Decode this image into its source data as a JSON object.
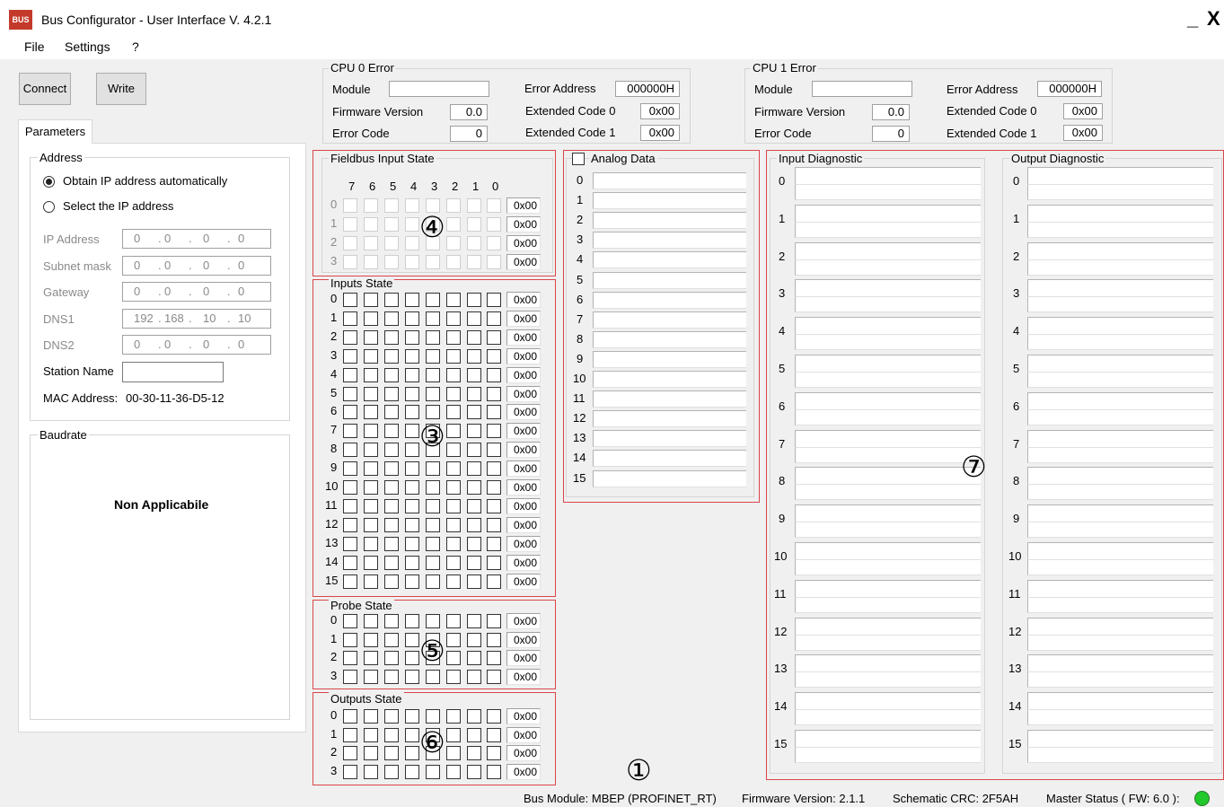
{
  "window": {
    "title": "Bus Configurator - User Interface  V. 4.2.1",
    "icon_label": "BUS",
    "minimize": "_",
    "close": "X"
  },
  "menu": [
    "File",
    "Settings",
    "?"
  ],
  "toolbar": {
    "connect": "Connect",
    "write": "Write"
  },
  "tab": "Parameters",
  "address": {
    "title": "Address",
    "radio_auto": "Obtain IP address automatically",
    "radio_manual": "Select the IP address",
    "fields": [
      {
        "label": "IP Address",
        "octets": [
          "0",
          "0",
          "0",
          "0"
        ]
      },
      {
        "label": "Subnet mask",
        "octets": [
          "0",
          "0",
          "0",
          "0"
        ]
      },
      {
        "label": "Gateway",
        "octets": [
          "0",
          "0",
          "0",
          "0"
        ]
      },
      {
        "label": "DNS1",
        "octets": [
          "192",
          "168",
          "10",
          "10"
        ]
      },
      {
        "label": "DNS2",
        "octets": [
          "0",
          "0",
          "0",
          "0"
        ]
      }
    ],
    "dot": ".",
    "station_name_label": "Station Name",
    "station_name_value": "",
    "mac_label": "MAC Address:",
    "mac_value": "00-30-11-36-D5-12"
  },
  "baudrate": {
    "title": "Baudrate",
    "value": "Non Applicabile"
  },
  "cpu0": {
    "title": "CPU 0 Error",
    "module_label": "Module",
    "module_value": "",
    "fw_label": "Firmware Version",
    "fw_value": "0.0",
    "code_label": "Error Code",
    "code_value": "0",
    "addr_label": "Error Address",
    "addr_value": "000000H",
    "ext0_label": "Extended Code 0",
    "ext0_value": "0x00",
    "ext1_label": "Extended Code 1",
    "ext1_value": "0x00"
  },
  "cpu1": {
    "title": "CPU 1 Error",
    "module_label": "Module",
    "module_value": "",
    "fw_label": "Firmware Version",
    "fw_value": "0.0",
    "code_label": "Error Code",
    "code_value": "0",
    "addr_label": "Error Address",
    "addr_value": "000000H",
    "ext0_label": "Extended Code 0",
    "ext0_value": "0x00",
    "ext1_label": "Extended Code 1",
    "ext1_value": "0x00"
  },
  "fieldbus": {
    "title": "Fieldbus Input State",
    "bits": [
      "7",
      "6",
      "5",
      "4",
      "3",
      "2",
      "1",
      "0"
    ],
    "rows": [
      "0",
      "1",
      "2",
      "3"
    ],
    "hex": [
      "0x00",
      "0x00",
      "0x00",
      "0x00"
    ],
    "marker": "④"
  },
  "inputs": {
    "title": "Inputs State",
    "rows": [
      "0",
      "1",
      "2",
      "3",
      "4",
      "5",
      "6",
      "7",
      "8",
      "9",
      "10",
      "11",
      "12",
      "13",
      "14",
      "15"
    ],
    "hex": [
      "0x00",
      "0x00",
      "0x00",
      "0x00",
      "0x00",
      "0x00",
      "0x00",
      "0x00",
      "0x00",
      "0x00",
      "0x00",
      "0x00",
      "0x00",
      "0x00",
      "0x00",
      "0x00"
    ],
    "marker": "③"
  },
  "probe": {
    "title": "Probe State",
    "rows": [
      "0",
      "1",
      "2",
      "3"
    ],
    "hex": [
      "0x00",
      "0x00",
      "0x00",
      "0x00"
    ],
    "marker": "⑤"
  },
  "outputs": {
    "title": "Outputs State",
    "rows": [
      "0",
      "1",
      "2",
      "3"
    ],
    "hex": [
      "0x00",
      "0x00",
      "0x00",
      "0x00"
    ],
    "marker": "⑥"
  },
  "analog": {
    "title": "Analog Data",
    "checked": false,
    "rows": [
      "0",
      "1",
      "2",
      "3",
      "4",
      "5",
      "6",
      "7",
      "8",
      "9",
      "10",
      "11",
      "12",
      "13",
      "14",
      "15"
    ]
  },
  "input_diag": {
    "title": "Input Diagnostic",
    "rows": [
      "0",
      "1",
      "2",
      "3",
      "4",
      "5",
      "6",
      "7",
      "8",
      "9",
      "10",
      "11",
      "12",
      "13",
      "14",
      "15"
    ]
  },
  "output_diag": {
    "title": "Output Diagnostic",
    "rows": [
      "0",
      "1",
      "2",
      "3",
      "4",
      "5",
      "6",
      "7",
      "8",
      "9",
      "10",
      "11",
      "12",
      "13",
      "14",
      "15"
    ]
  },
  "diag_marker": "⑦",
  "status": {
    "module": "Bus Module: MBEP (PROFINET_RT)",
    "firmware": "Firmware Version: 2.1.1",
    "crc": "Schematic CRC: 2F5AH",
    "master": "Master Status ( FW: 6.0 ):",
    "master_color": "#21c92a",
    "marker": "①"
  },
  "colors": {
    "annotation_red": "#d9454a",
    "panel_bg": "#f0f0f0"
  }
}
